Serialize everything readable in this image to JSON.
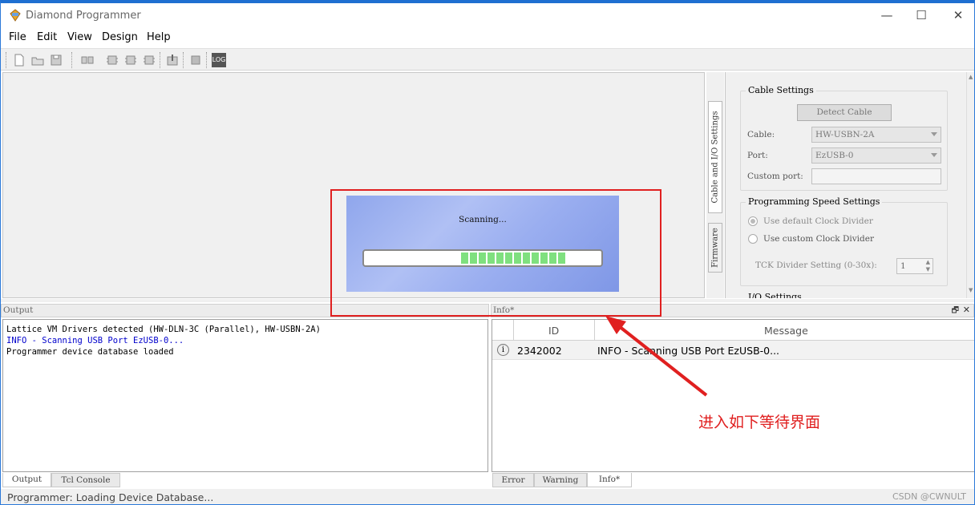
{
  "window": {
    "title": "Diamond Programmer",
    "controls": {
      "minimize": "—",
      "maximize": "☐",
      "close": "✕"
    }
  },
  "menu": [
    "File",
    "Edit",
    "View",
    "Design",
    "Help"
  ],
  "toolbar_icons": [
    "new-file-icon",
    "open-file-icon",
    "save-icon",
    "chip-chain-icon",
    "chip-1-icon",
    "chip-2-icon",
    "chip-3-icon",
    "program-icon",
    "device-icon",
    "log-icon"
  ],
  "toolbar_log_label": "LOG",
  "side_tabs": [
    "Cable and I/O Settings",
    "Firmware"
  ],
  "settings": {
    "cable_group": "Cable Settings",
    "detect_button": "Detect Cable",
    "cable_label": "Cable:",
    "cable_value": "HW-USBN-2A",
    "port_label": "Port:",
    "port_value": "EzUSB-0",
    "custom_port_label": "Custom port:",
    "custom_port_value": "",
    "speed_group": "Programming Speed Settings",
    "radio_default": "Use default Clock Divider",
    "radio_custom": "Use custom Clock Divider",
    "tck_label": "TCK Divider Setting (0-30x):",
    "tck_value": "1",
    "io_group": "I/O Settings"
  },
  "splash": {
    "text": "Scanning...",
    "progress_segments": 12,
    "progress_start_fraction": 0.41
  },
  "output": {
    "header": "Output",
    "lines": [
      {
        "text": "Lattice VM Drivers detected (HW-DLN-3C (Parallel), HW-USBN-2A)",
        "color": "#000000"
      },
      {
        "text": "INFO - Scanning USB Port EzUSB-0...",
        "color": "#0000cc"
      },
      {
        "text": "Programmer device database loaded",
        "color": "#000000"
      }
    ],
    "tabs": [
      "Output",
      "Tcl Console"
    ]
  },
  "info": {
    "header": "Info*",
    "columns": [
      "ID",
      "Message"
    ],
    "rows": [
      {
        "id": "2342002",
        "message": "INFO - Scanning USB Port EzUSB-0..."
      }
    ],
    "tabs": [
      "Error",
      "Warning",
      "Info*"
    ]
  },
  "status": "Programmer: Loading Device Database...",
  "annotation": "进入如下等待界面",
  "watermark": "CSDN @CWNULT",
  "colors": {
    "accent": "#1e6fd1",
    "annotation": "#e02020",
    "progress": "#7fe07f"
  }
}
